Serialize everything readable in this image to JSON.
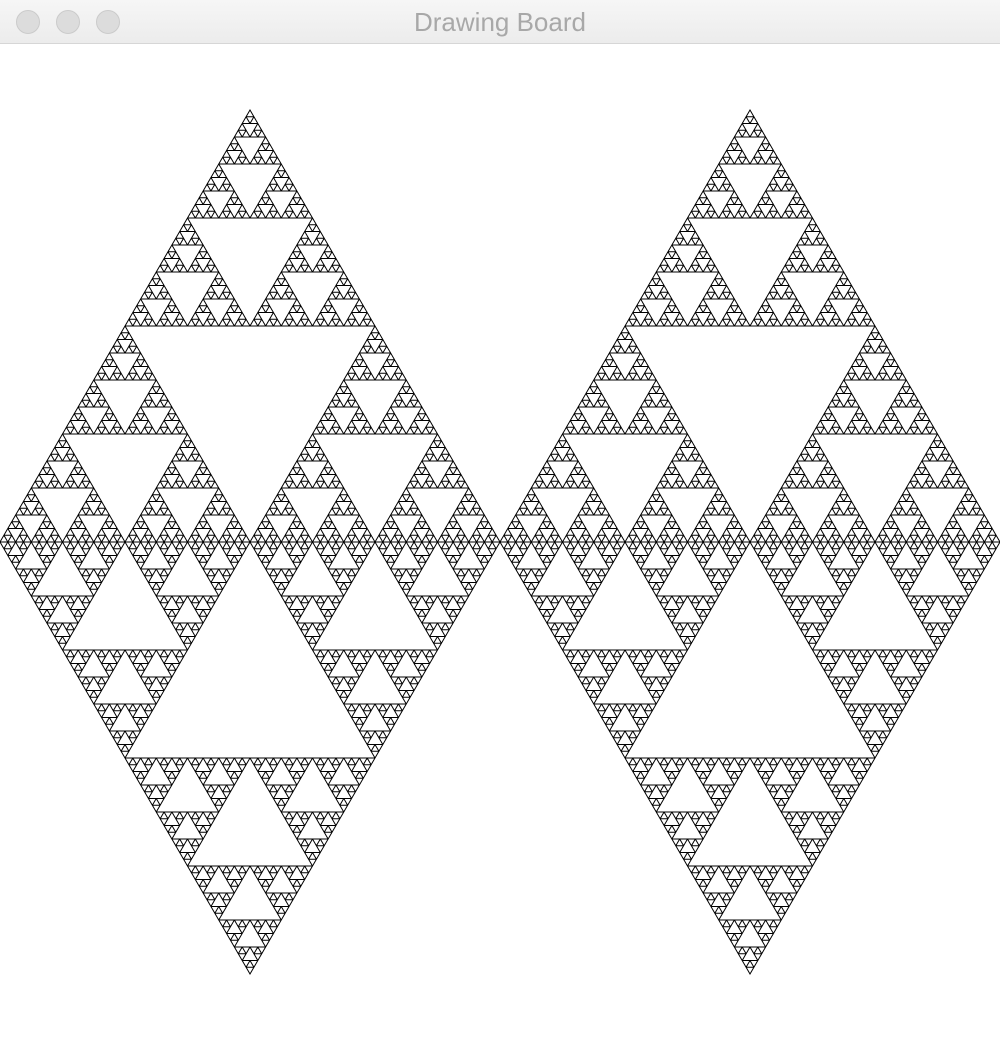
{
  "window": {
    "title": "Drawing Board"
  },
  "drawing": {
    "shape": "sierpinski-triangle-diamonds",
    "diamond_count": 2,
    "recursion_depth": 6,
    "stroke_color": "#000000",
    "background_color": "#ffffff"
  },
  "icons": {
    "close": "close-icon",
    "minimize": "minimize-icon",
    "zoom": "zoom-icon"
  }
}
